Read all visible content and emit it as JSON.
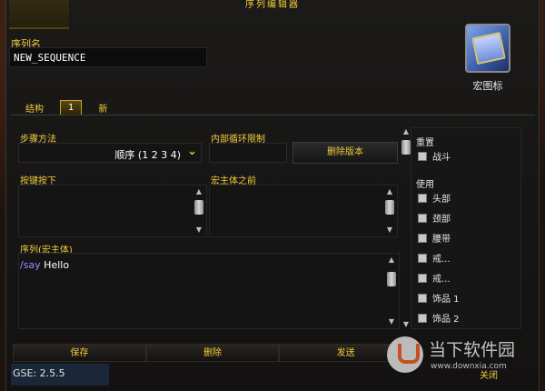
{
  "window": {
    "title": "序列编辑器"
  },
  "sequence": {
    "name_label": "序列名",
    "name_value": "NEW_SEQUENCE"
  },
  "macro_icon": {
    "label": "宏图标"
  },
  "tabs": [
    {
      "label": "结构",
      "active": false
    },
    {
      "label": "1",
      "active": true
    },
    {
      "label": "新",
      "active": false
    }
  ],
  "step": {
    "label": "步骤方法",
    "value": "顺序 (1 2 3 4)"
  },
  "inner_loop": {
    "label": "内部循环限制",
    "value": ""
  },
  "delete_version_label": "删除版本",
  "keypress": {
    "label": "按键按下"
  },
  "premacro": {
    "label": "宏主体之前"
  },
  "sequence_body": {
    "label": "序列(宏主体)",
    "command": "/say",
    "text": " Hello"
  },
  "options": {
    "reset_label": "重置",
    "reset_items": [
      "战斗"
    ],
    "use_label": "使用",
    "use_items": [
      "头部",
      "颈部",
      "腰带",
      "戒...",
      "戒...",
      "饰品 1",
      "饰品 2"
    ]
  },
  "buttons": {
    "save": "保存",
    "delete": "删除",
    "send": "发送",
    "close": "关闭"
  },
  "status": {
    "version": "GSE: 2.5.5"
  },
  "watermark": {
    "title": "当下软件园",
    "url": "www.downxia.com"
  },
  "colors": {
    "gold": "#f2cc3a",
    "command": "#9a8cff"
  }
}
